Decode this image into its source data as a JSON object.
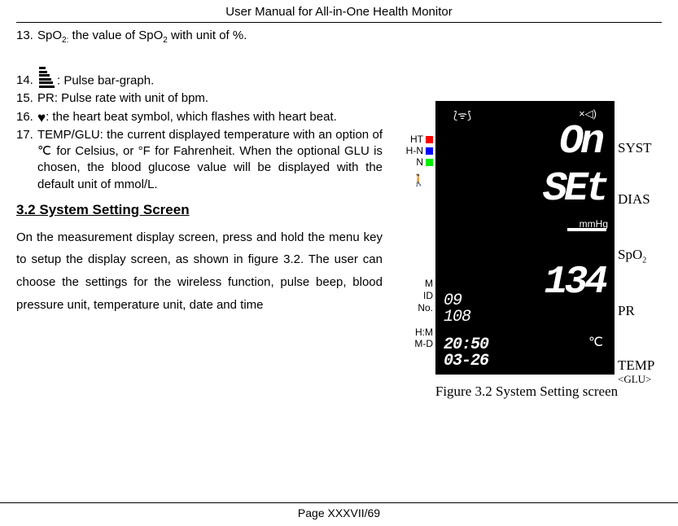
{
  "header_title": "User Manual for All-in-One Health Monitor",
  "items": {
    "i13": {
      "num": "13.",
      "text_before": "SpO",
      "sub1": "2:",
      "text_mid": " the value of SpO",
      "sub2": "2",
      "text_after": " with unit of %."
    },
    "i14": {
      "num": "14.",
      "text": ": Pulse bar-graph."
    },
    "i15": {
      "num": "15.",
      "text": "PR: Pulse rate with unit of bpm."
    },
    "i16": {
      "num": "16.",
      "text": ": the heart beat symbol, which flashes with heart beat."
    },
    "i17": {
      "num": "17.",
      "text": "TEMP/GLU: the current displayed temperature with an option of ℃ for Celsius, or °F for Fahrenheit. When the optional GLU is chosen, the blood glucose value will be displayed with the default unit of mmol/L."
    }
  },
  "section_heading": "3.2 System Setting Screen",
  "section_para": "On the measurement display screen, press and hold the menu key to setup the display screen, as shown in figure 3.2. The user can choose the settings for the wireless function, pulse beep, blood pressure unit, temperature unit, date and time",
  "figure_caption": "Figure 3.2 System Setting screen",
  "device": {
    "left_labels": {
      "ht": "HT",
      "hn": "H-N",
      "n": "N"
    },
    "left_lower": {
      "m": "M",
      "id": "ID",
      "no": "No."
    },
    "left_bottom": {
      "hm": "H:M",
      "md": "M-D"
    },
    "topbar": {
      "wifi": "⟅ᯤ⟆",
      "mute": "×◁)"
    },
    "on": "On",
    "set": "SEt",
    "mmhg": "mmHg",
    "pr": "134",
    "sm1": "09",
    "sm2": "108",
    "time1": "20:50",
    "time2": "03-26",
    "degc": "℃",
    "right": {
      "syst": "SYST",
      "dias": "DIAS",
      "spo2_a": "SpO",
      "spo2_b": "2",
      "pr": "PR",
      "temp": "TEMP",
      "glu": "<GLU>"
    }
  },
  "footer": "Page XXXVII/69"
}
